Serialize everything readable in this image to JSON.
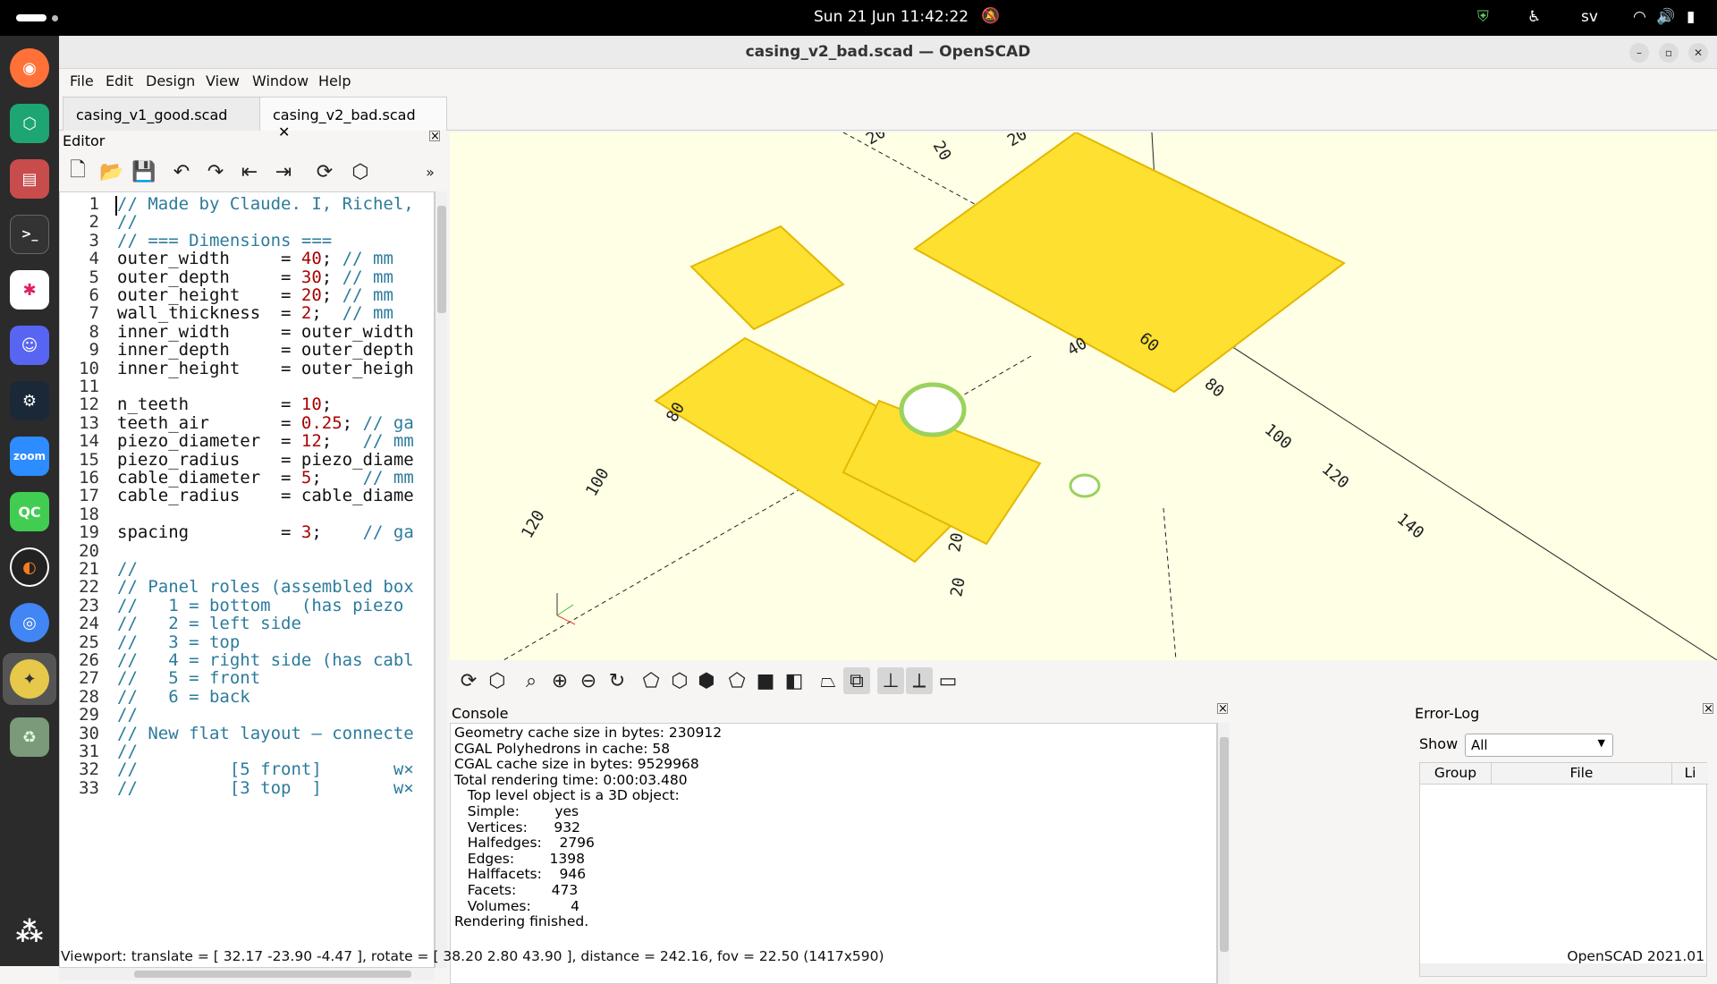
{
  "topbar": {
    "clock": "Sun 21 Jun  11:42:22",
    "lang": "sv"
  },
  "window": {
    "title": "casing_v2_bad.scad — OpenSCAD"
  },
  "menu": [
    "File",
    "Edit",
    "Design",
    "View",
    "Window",
    "Help"
  ],
  "tabs": [
    {
      "label": "casing_v1_good.scad"
    },
    {
      "label": "casing_v2_bad.scad",
      "close": "✕"
    }
  ],
  "editor": {
    "title": "Editor",
    "lines": [
      "// Made by Claude. I, Richel,",
      "//",
      "// === Dimensions ===",
      "outer_width     = 40; // mm",
      "outer_depth     = 30; // mm",
      "outer_height    = 20; // mm",
      "wall_thickness  = 2;  // mm",
      "inner_width     = outer_width",
      "inner_depth     = outer_depth",
      "inner_height    = outer_heigh",
      "",
      "n_teeth         = 10;",
      "teeth_air       = 0.25; // ga",
      "piezo_diameter  = 12;   // mm",
      "piezo_radius    = piezo_diame",
      "cable_diameter  = 5;    // mm",
      "cable_radius    = cable_diame",
      "",
      "spacing         = 3;    // ga",
      "",
      "//",
      "// Panel roles (assembled box",
      "//   1 = bottom   (has piezo",
      "//   2 = left side",
      "//   3 = top",
      "//   4 = right side (has cabl",
      "//   5 = front",
      "//   6 = back",
      "//",
      "// New flat layout — connecte",
      "//",
      "//         [5 front]       w×",
      "//         [3 top  ]       w×"
    ]
  },
  "viewport_labels": [
    "20",
    "20",
    "20",
    "40",
    "60",
    "80",
    "100",
    "120",
    "140",
    "80",
    "100",
    "120",
    "20",
    "20"
  ],
  "console": {
    "title": "Console",
    "lines": [
      "Geometry cache size in bytes: 230912",
      "CGAL Polyhedrons in cache: 58",
      "CGAL cache size in bytes: 9529968",
      "Total rendering time: 0:00:03.480",
      "   Top level object is a 3D object:",
      "   Simple:        yes",
      "   Vertices:      932",
      "   Halfedges:    2796",
      "   Edges:        1398",
      "   Halffacets:    946",
      "   Facets:        473",
      "   Volumes:         4",
      "Rendering finished."
    ]
  },
  "errorlog": {
    "title": "Error-Log",
    "show_label": "Show",
    "show_value": "All",
    "columns": [
      "Group",
      "File",
      "Li"
    ]
  },
  "status": {
    "viewport": "Viewport: translate = [ 32.17 -23.90 -4.47 ], rotate = [ 38.20 2.80 43.90 ], distance = 242.16, fov = 22.50 (1417x590)",
    "version": "OpenSCAD 2021.01"
  },
  "colors": {
    "model": "#fde030",
    "viewport_bg": "#ffffe5"
  }
}
